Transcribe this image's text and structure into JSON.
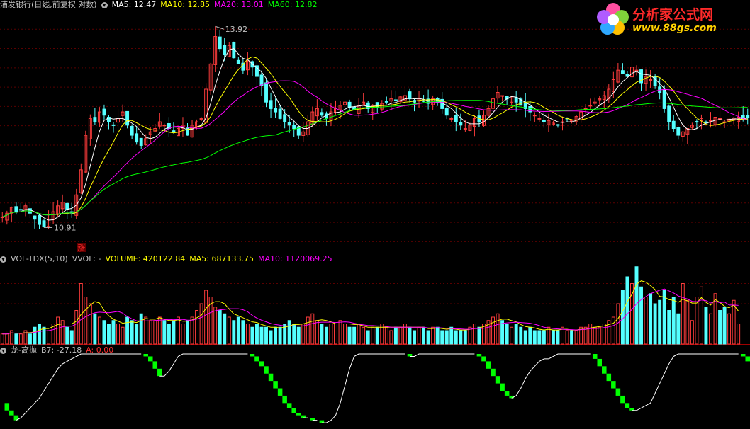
{
  "colors": {
    "bg": "#000000",
    "grid": "#5a0000",
    "up": "#ff3c3c",
    "down": "#54ffff",
    "ma5": "#ffffff",
    "ma10": "#ffff00",
    "ma20": "#ff00ff",
    "ma60": "#00ff00",
    "volma5": "#ffff00",
    "volma10": "#ff00ff",
    "osc_line": "#ffffff",
    "osc_block": "#00ff00",
    "zhang": "#ff2a2a"
  },
  "header_price": {
    "title": "浦发银行(日线,前复权 对数)",
    "ma5": "MA5: 12.47",
    "ma10": "MA10: 12.85",
    "ma20": "MA20: 13.01",
    "ma60": "MA60: 12.82"
  },
  "header_volume": {
    "title": "VOL-TDX(5,10)",
    "vvol": "VVOL: -",
    "volume": "VOLUME: 420122.84",
    "ma5": "MA5: 687133.75",
    "ma10": "MA10: 1120069.25"
  },
  "header_osc": {
    "title": "龙-高抛",
    "b7": "B7: -27.18",
    "a": "A: 0.00"
  },
  "annotations": {
    "high": "13.92",
    "low": "10.91",
    "marker": "涨"
  },
  "logo": {
    "line1": "分析家公式网",
    "line2": "www.88gs.com"
  },
  "chart_data": [
    {
      "type": "candlestick",
      "title": "浦发银行(日线,前复权 对数)",
      "ylim": [
        10.6,
        14.2
      ],
      "x_count": 160,
      "annotated_high": 13.92,
      "annotated_low": 10.91,
      "series_legend": [
        "MA5",
        "MA10",
        "MA20",
        "MA60"
      ],
      "closes": [
        11.05,
        11.1,
        11.18,
        11.12,
        11.15,
        11.2,
        11.1,
        11.02,
        10.95,
        10.92,
        11.05,
        11.12,
        11.2,
        11.25,
        11.15,
        11.1,
        11.35,
        11.7,
        12.2,
        12.45,
        12.4,
        12.55,
        12.5,
        12.4,
        12.35,
        12.45,
        12.55,
        12.35,
        12.2,
        12.1,
        12.05,
        12.15,
        12.25,
        12.3,
        12.4,
        12.35,
        12.3,
        12.25,
        12.3,
        12.35,
        12.2,
        12.35,
        12.4,
        12.45,
        12.9,
        13.3,
        13.75,
        13.55,
        13.45,
        13.6,
        13.4,
        13.3,
        13.2,
        13.35,
        13.25,
        13.1,
        12.95,
        12.7,
        12.6,
        12.55,
        12.45,
        12.4,
        12.35,
        12.3,
        12.2,
        12.25,
        12.4,
        12.55,
        12.6,
        12.5,
        12.45,
        12.55,
        12.6,
        12.65,
        12.7,
        12.62,
        12.58,
        12.65,
        12.7,
        12.6,
        12.65,
        12.62,
        12.68,
        12.7,
        12.75,
        12.72,
        12.78,
        12.8,
        12.75,
        12.7,
        12.75,
        12.72,
        12.68,
        12.75,
        12.7,
        12.6,
        12.5,
        12.45,
        12.4,
        12.35,
        12.3,
        12.35,
        12.45,
        12.4,
        12.5,
        12.6,
        12.75,
        12.85,
        12.8,
        12.75,
        12.78,
        12.7,
        12.65,
        12.6,
        12.55,
        12.5,
        12.45,
        12.4,
        12.42,
        12.38,
        12.35,
        12.4,
        12.45,
        12.42,
        12.48,
        12.55,
        12.6,
        12.65,
        12.7,
        12.75,
        12.8,
        12.9,
        13.05,
        13.2,
        13.15,
        13.1,
        13.25,
        13.2,
        13.0,
        13.1,
        13.05,
        12.95,
        12.85,
        12.6,
        12.4,
        12.3,
        12.2,
        12.25,
        12.3,
        12.35,
        12.4,
        12.45,
        12.38,
        12.42,
        12.47,
        12.45,
        12.4,
        12.44,
        12.46,
        12.47,
        12.45,
        12.47
      ],
      "ma_periods": [
        5,
        10,
        20,
        60
      ]
    },
    {
      "type": "bar",
      "title": "VOL-TDX(5,10)",
      "series_legend": [
        "VOLUME",
        "MA5",
        "MA10"
      ],
      "last_volume": 420122.84,
      "ma5": 687133.75,
      "ma10": 1120069.25,
      "volumes": [
        3,
        3,
        4,
        3,
        3,
        4,
        3,
        5,
        6,
        5,
        4,
        6,
        8,
        7,
        5,
        4,
        10,
        18,
        14,
        12,
        9,
        8,
        7,
        6,
        7,
        6,
        5,
        8,
        7,
        6,
        9,
        8,
        7,
        7,
        8,
        7,
        6,
        7,
        8,
        6,
        7,
        8,
        10,
        12,
        16,
        14,
        11,
        10,
        9,
        8,
        7,
        8,
        7,
        6,
        5,
        6,
        5,
        5,
        4,
        5,
        5,
        6,
        7,
        6,
        5,
        6,
        8,
        9,
        7,
        6,
        5,
        6,
        6,
        7,
        6,
        5,
        5,
        6,
        5,
        4,
        5,
        5,
        6,
        5,
        4,
        5,
        5,
        6,
        5,
        4,
        5,
        5,
        4,
        5,
        5,
        4,
        4,
        5,
        4,
        4,
        4,
        5,
        6,
        5,
        6,
        7,
        8,
        9,
        7,
        6,
        5,
        6,
        5,
        4,
        5,
        4,
        4,
        4,
        5,
        4,
        4,
        5,
        4,
        4,
        4,
        5,
        5,
        6,
        5,
        5,
        6,
        7,
        8,
        12,
        16,
        20,
        18,
        23,
        17,
        14,
        15,
        12,
        13,
        16,
        10,
        14,
        9,
        18,
        13,
        7,
        14,
        17,
        11,
        9,
        15,
        10,
        11,
        9,
        13,
        6
      ],
      "ylim": [
        0,
        24
      ]
    },
    {
      "type": "line",
      "title": "龙-高抛",
      "series_legend": [
        "B7",
        "A"
      ],
      "b7_last": -27.18,
      "a_last": 0.0,
      "ylim": [
        -30,
        0
      ],
      "values": [
        -20,
        -23,
        -25,
        -27,
        -26,
        -24,
        -22,
        -20,
        -18,
        -15,
        -12,
        -9,
        -6,
        -4,
        -3,
        -2,
        -1,
        0,
        0,
        0,
        0,
        0,
        0,
        0,
        0,
        0,
        0,
        0,
        0,
        0,
        0,
        -1,
        -3,
        -6,
        -9,
        -9,
        -7,
        -4,
        -1,
        0,
        0,
        0,
        0,
        0,
        0,
        0,
        0,
        0,
        0,
        0,
        0,
        0,
        0,
        0,
        -1,
        -3,
        -5,
        -8,
        -11,
        -14,
        -17,
        -20,
        -22,
        -24,
        -25,
        -26,
        -26,
        -27,
        -27,
        -28,
        -28,
        -27,
        -25,
        -20,
        -13,
        -6,
        -1,
        0,
        0,
        0,
        0,
        0,
        0,
        0,
        0,
        0,
        0,
        0,
        -1,
        -1,
        0,
        0,
        0,
        0,
        0,
        0,
        0,
        0,
        0,
        0,
        0,
        0,
        0,
        -1,
        -3,
        -6,
        -9,
        -12,
        -15,
        -17,
        -18,
        -17,
        -14,
        -10,
        -7,
        -5,
        -3,
        -2,
        -2,
        -1,
        0,
        0,
        0,
        0,
        0,
        0,
        0,
        0,
        -2,
        -5,
        -8,
        -11,
        -14,
        -17,
        -20,
        -22,
        -23,
        -23,
        -22,
        -21,
        -20,
        -16,
        -12,
        -8,
        -4,
        -1,
        0,
        0,
        0,
        0,
        0,
        0,
        0,
        0,
        0,
        0,
        0,
        0,
        0,
        0,
        -1,
        -3,
        -6,
        -9,
        -11
      ]
    }
  ]
}
